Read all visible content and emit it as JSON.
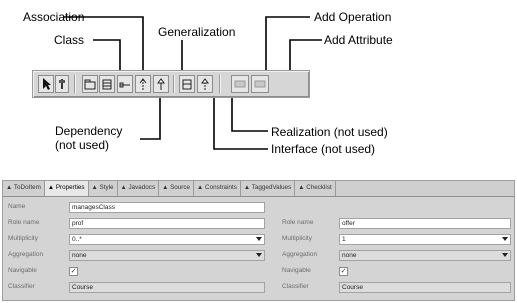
{
  "callouts": {
    "association": "Association",
    "class": "Class",
    "generalization": "Generalization",
    "add_operation": "Add Operation",
    "add_attribute": "Add Attribute",
    "dependency_line1": "Dependency",
    "dependency_line2": "(not used)",
    "realization": "Realization (not used)",
    "interface": "Interface (not used)"
  },
  "toolbar": {
    "buttons": [
      {
        "name": "select",
        "icon": "arrow-pointer-icon"
      },
      {
        "name": "note",
        "icon": "pin-icon"
      },
      {
        "name": "package",
        "icon": "package-icon"
      },
      {
        "name": "class",
        "icon": "class-icon"
      },
      {
        "name": "association",
        "icon": "association-line-icon"
      },
      {
        "name": "dependency",
        "icon": "dependency-arrow-icon"
      },
      {
        "name": "generalization",
        "icon": "generalization-arrow-icon"
      },
      {
        "name": "interface",
        "icon": "interface-icon"
      },
      {
        "name": "realization",
        "icon": "realization-arrow-icon"
      },
      {
        "name": "add-operation",
        "icon": "operation-icon"
      },
      {
        "name": "add-attribute",
        "icon": "attribute-icon"
      }
    ]
  },
  "panel": {
    "tabs": [
      "ToDoItem",
      "Properties",
      "Style",
      "Javadocs",
      "Source",
      "Constraints",
      "TaggedValues",
      "Checklist"
    ],
    "active_tab": "Properties",
    "name_label": "Name",
    "name_value": "managesClass",
    "left": {
      "role_name_label": "Role name",
      "role_name_value": "prof",
      "multiplicity_label": "Multiplicity",
      "multiplicity_value": "0..*",
      "aggregation_label": "Aggregation",
      "aggregation_value": "none",
      "navigable_label": "Navigable",
      "navigable_value": "✓",
      "classifier_label": "Classifier",
      "classifier_value": "Course"
    },
    "right": {
      "role_name_label": "Role name",
      "role_name_value": "offer",
      "multiplicity_label": "Multiplicity",
      "multiplicity_value": "1",
      "aggregation_label": "Aggregation",
      "aggregation_value": "none",
      "navigable_label": "Navigable",
      "navigable_value": "✓",
      "classifier_label": "Classifier",
      "classifier_value": "Course"
    }
  }
}
